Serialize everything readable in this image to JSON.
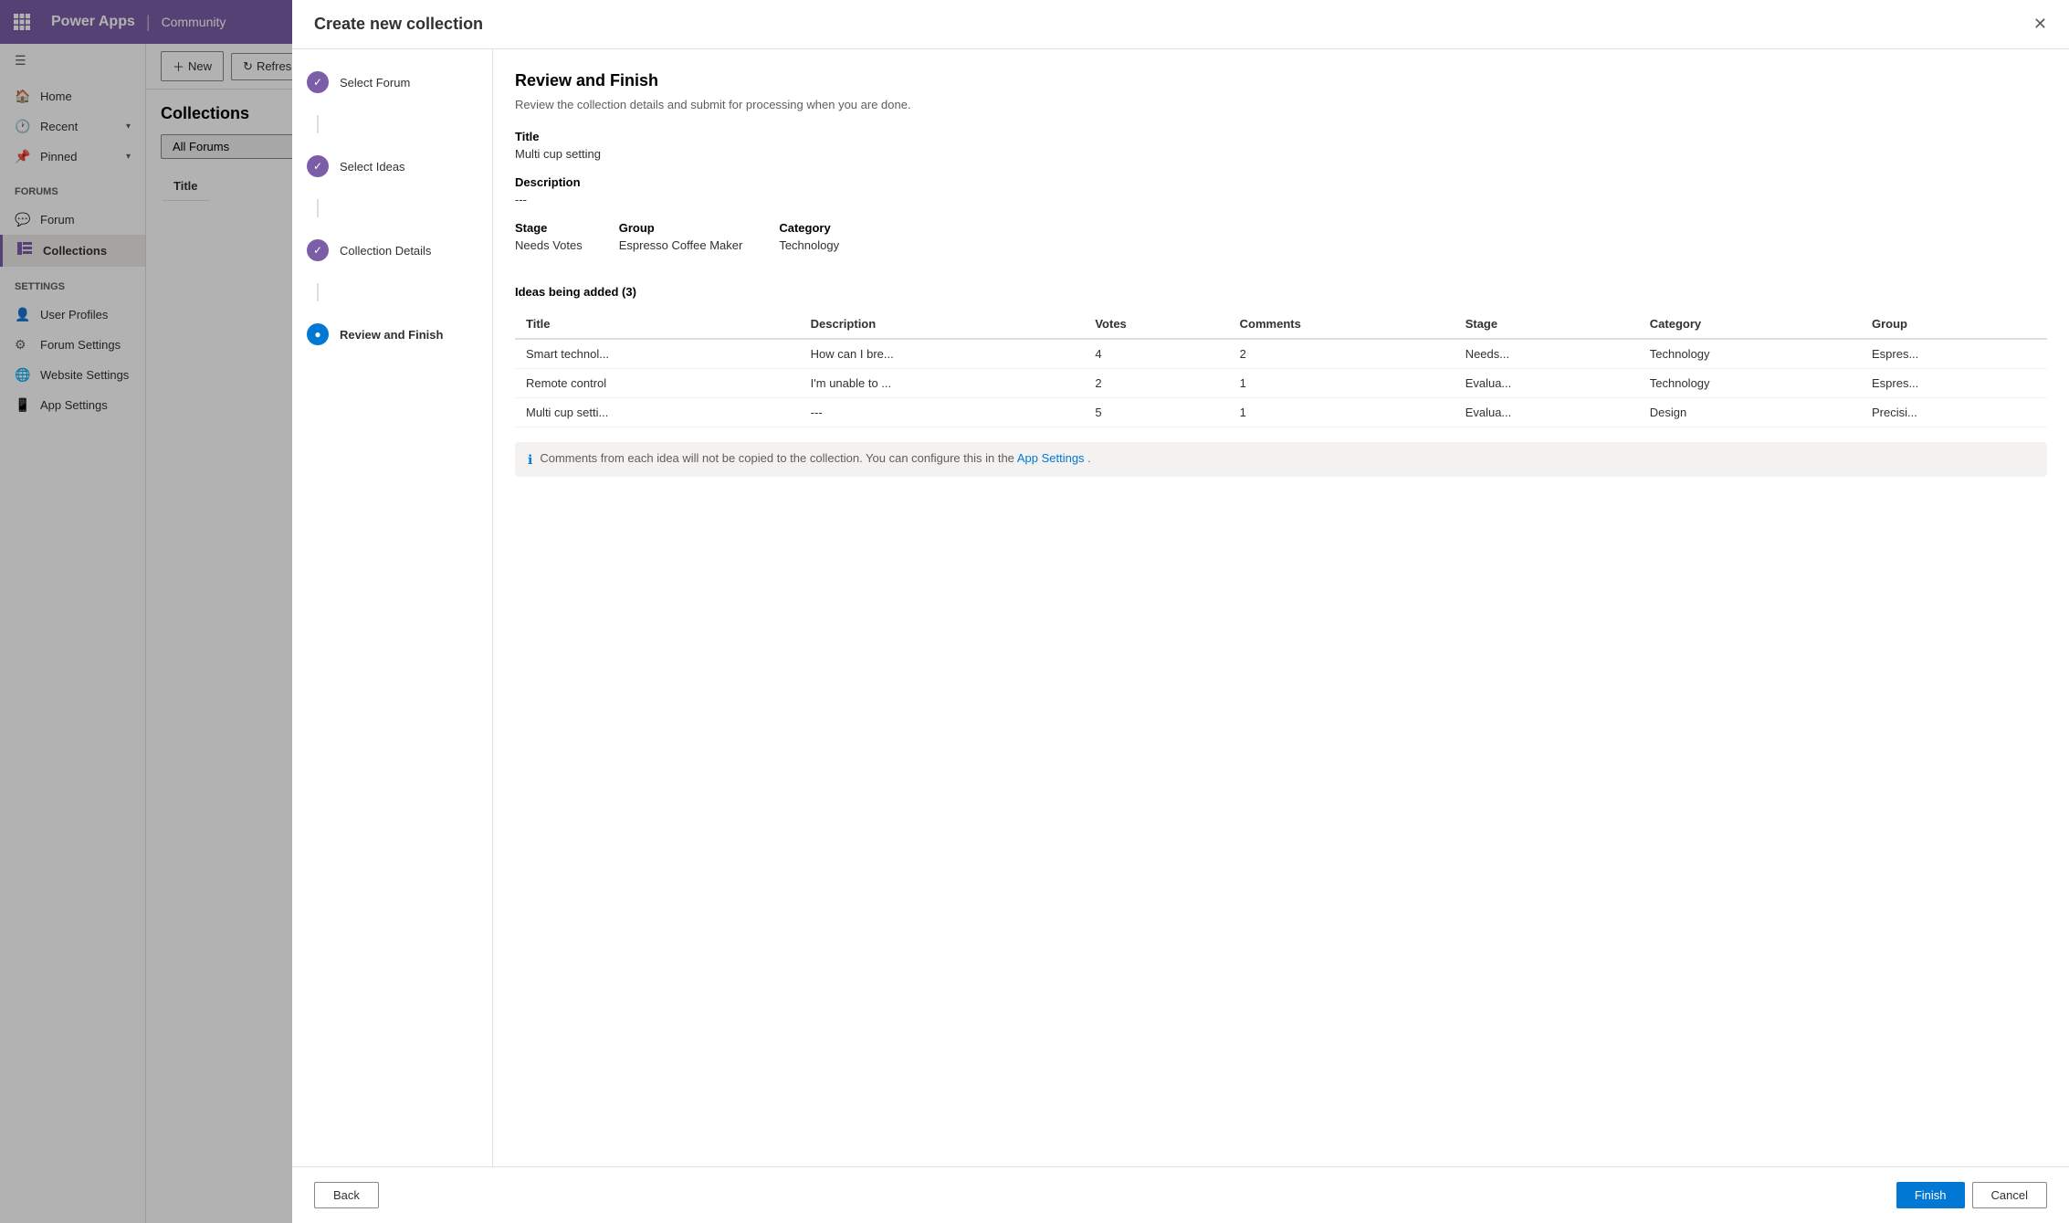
{
  "topbar": {
    "app_name": "Power Apps",
    "community": "Community",
    "divider": "|"
  },
  "sidebar": {
    "menu_icon": "☰",
    "items": [
      {
        "id": "home",
        "label": "Home",
        "icon": "🏠",
        "active": false
      },
      {
        "id": "recent",
        "label": "Recent",
        "icon": "🕐",
        "chevron": "▾",
        "active": false
      },
      {
        "id": "pinned",
        "label": "Pinned",
        "icon": "📌",
        "chevron": "▾",
        "active": false
      }
    ],
    "forums_group": "Forums",
    "forum_items": [
      {
        "id": "forum",
        "label": "Forum",
        "icon": "💬",
        "active": false
      },
      {
        "id": "collections",
        "label": "Collections",
        "icon": "📋",
        "active": true
      }
    ],
    "settings_group": "Settings",
    "settings_items": [
      {
        "id": "user-profiles",
        "label": "User Profiles",
        "icon": "👤",
        "active": false
      },
      {
        "id": "forum-settings",
        "label": "Forum Settings",
        "icon": "⚙",
        "active": false
      },
      {
        "id": "website-settings",
        "label": "Website Settings",
        "icon": "🌐",
        "active": false
      },
      {
        "id": "app-settings",
        "label": "App Settings",
        "icon": "📱",
        "active": false
      }
    ]
  },
  "toolbar": {
    "new_label": "New",
    "refresh_label": "Refresh"
  },
  "collections_panel": {
    "title": "Collections",
    "forum_filter_placeholder": "All Forums",
    "table_header": "Title"
  },
  "modal": {
    "title": "Create new collection",
    "wizard_steps": [
      {
        "id": "select-forum",
        "label": "Select Forum",
        "state": "completed"
      },
      {
        "id": "select-ideas",
        "label": "Select Ideas",
        "state": "completed"
      },
      {
        "id": "collection-details",
        "label": "Collection Details",
        "state": "completed"
      },
      {
        "id": "review-finish",
        "label": "Review and Finish",
        "state": "active"
      }
    ],
    "review": {
      "title": "Review and Finish",
      "subtitle": "Review the collection details and submit for processing when you are done.",
      "title_label": "Title",
      "title_value": "Multi cup setting",
      "description_label": "Description",
      "description_value": "---",
      "stage_label": "Stage",
      "stage_value": "Needs Votes",
      "group_label": "Group",
      "group_value": "Espresso Coffee Maker",
      "category_label": "Category",
      "category_value": "Technology",
      "ideas_being_added": "Ideas being added (3)",
      "table_headers": [
        "Title",
        "Description",
        "Votes",
        "Comments",
        "Stage",
        "Category",
        "Group"
      ],
      "ideas": [
        {
          "title": "Smart technol...",
          "description": "How can I bre...",
          "votes": "4",
          "comments": "2",
          "stage": "Needs...",
          "category": "Technology",
          "group": "Espres..."
        },
        {
          "title": "Remote control",
          "description": "I'm unable to ...",
          "votes": "2",
          "comments": "1",
          "stage": "Evalua...",
          "category": "Technology",
          "group": "Espres..."
        },
        {
          "title": "Multi cup setti...",
          "description": "---",
          "votes": "5",
          "comments": "1",
          "stage": "Evalua...",
          "category": "Design",
          "group": "Precisi..."
        }
      ],
      "info_message": "Comments from each idea will not be copied to the collection. You can configure this in the",
      "info_link_text": "App Settings",
      "info_message_end": "."
    },
    "footer": {
      "back_label": "Back",
      "finish_label": "Finish",
      "cancel_label": "Cancel"
    }
  }
}
